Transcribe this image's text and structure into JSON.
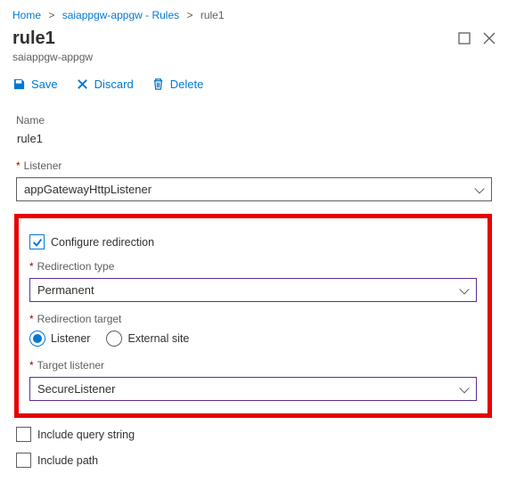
{
  "breadcrumb": {
    "items": [
      {
        "label": "Home"
      },
      {
        "label": "saiappgw-appgw - Rules"
      }
    ],
    "current": "rule1"
  },
  "header": {
    "title": "rule1",
    "subtitle": "saiappgw-appgw"
  },
  "toolbar": {
    "save": "Save",
    "discard": "Discard",
    "delete": "Delete"
  },
  "form": {
    "name_label": "Name",
    "name_value": "rule1",
    "listener_label": "Listener",
    "listener_value": "appGatewayHttpListener",
    "configure_redirection": "Configure redirection",
    "redirection_type_label": "Redirection type",
    "redirection_type_value": "Permanent",
    "redirection_target_label": "Redirection target",
    "target_options": {
      "listener": "Listener",
      "external": "External site"
    },
    "target_listener_label": "Target listener",
    "target_listener_value": "SecureListener",
    "include_query": "Include query string",
    "include_path": "Include path"
  }
}
